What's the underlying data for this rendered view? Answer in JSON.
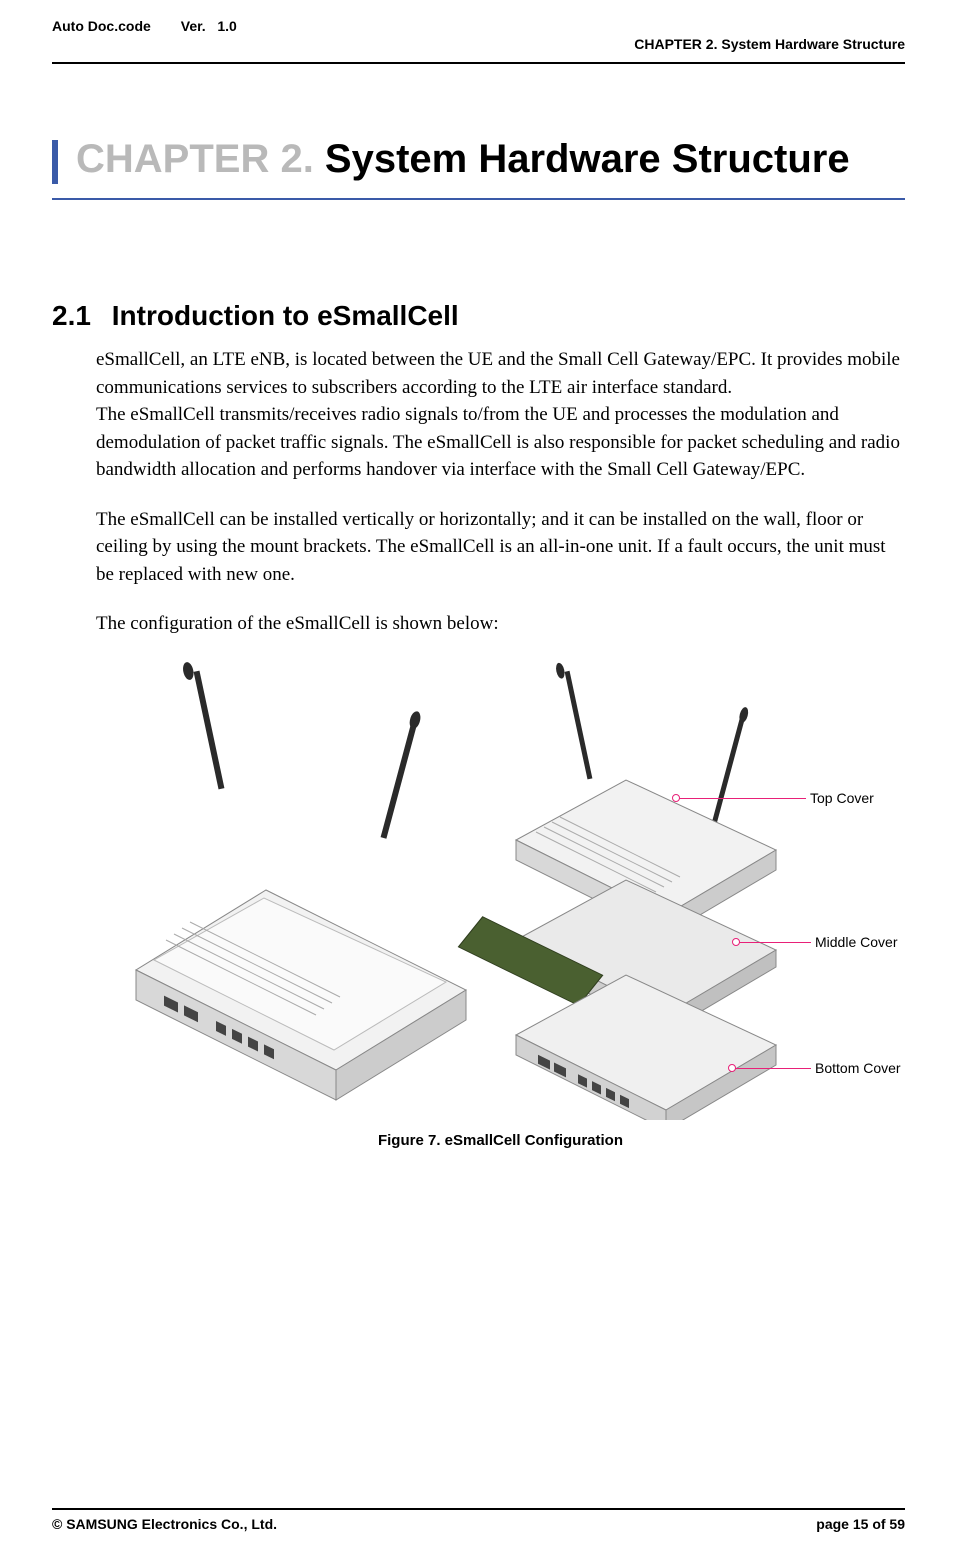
{
  "header": {
    "doc_code_label": "Auto Doc.code",
    "ver_label": "Ver.",
    "ver_value": "1.0",
    "chapter_running": "CHAPTER 2. System Hardware Structure"
  },
  "chapter": {
    "prefix": "CHAPTER 2.",
    "title_rest": " System Hardware Structure"
  },
  "section": {
    "number": "2.1",
    "title": "Introduction to eSmallCell",
    "para1": "eSmallCell, an LTE eNB, is located between the UE and the Small Cell Gateway/EPC. It provides mobile communications services to subscribers according to the LTE air interface standard.",
    "para1b": "The eSmallCell transmits/receives radio signals to/from the UE and processes the modulation and demodulation of packet traffic signals. The eSmallCell is also responsible for packet scheduling and radio bandwidth allocation and performs handover via interface with the Small Cell Gateway/EPC.",
    "para2": "The eSmallCell can be installed vertically or horizontally; and it can be installed on the wall, floor or ceiling by using the mount brackets. The eSmallCell is an all-in-one unit. If a fault occurs, the unit must be replaced with new one.",
    "para3": "The configuration of the eSmallCell is shown below:"
  },
  "figure": {
    "callouts": {
      "top": "Top Cover",
      "middle": "Middle Cover",
      "bottom": "Bottom Cover"
    },
    "caption": "Figure 7. eSmallCell Configuration"
  },
  "footer": {
    "copyright": "© SAMSUNG Electronics Co., Ltd.",
    "page": "page 15 of 59"
  }
}
